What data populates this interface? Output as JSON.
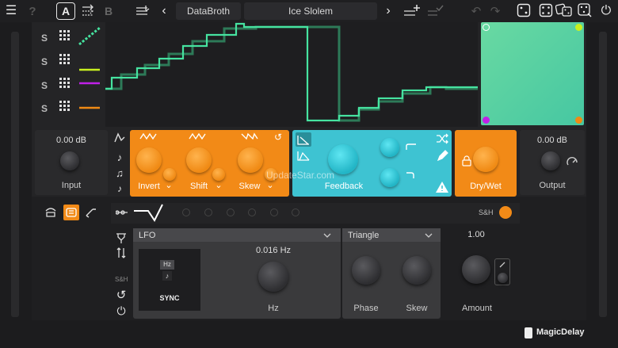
{
  "toolbar": {
    "menu_icon": "hamburger-icon",
    "help": "?",
    "a_label": "A",
    "b_label": "B",
    "prev": "‹",
    "next": "›",
    "preset_bank": "DataBroth",
    "preset_name": "Ice Slolem"
  },
  "lanes": {
    "s_labels": [
      "S",
      "S",
      "S",
      "S"
    ],
    "colors": [
      "#46e3a0",
      "#c8f020",
      "#c020e8",
      "#f08a14"
    ]
  },
  "graph": {
    "freq_labels": [
      "",
      "",
      ""
    ]
  },
  "xy_pad": {
    "corner_colors": [
      "#e8e8e8",
      "#c8f020",
      "#c020e8",
      "#f08a14"
    ]
  },
  "input": {
    "value": "0.00 dB",
    "label": "Input"
  },
  "output": {
    "value": "0.00 dB",
    "label": "Output"
  },
  "orange_section": {
    "invert_label": "Invert",
    "shift_label": "Shift",
    "skew_label": "Skew",
    "chev": "⌄"
  },
  "feedback": {
    "label": "Feedback"
  },
  "drywet": {
    "label": "Dry/Wet"
  },
  "watermark": "UpdateStar.com",
  "mod": {
    "sh_label": "S&H",
    "lfo": {
      "source": "LFO",
      "freq_value": "0.016 Hz",
      "freq_label": "Hz",
      "sync_label": "SYNC",
      "hz_badge": "Hz",
      "note_badge": "♪"
    },
    "shape": {
      "name": "Triangle",
      "phase_label": "Phase",
      "skew_label": "Skew"
    },
    "amount": {
      "value": "1.00",
      "label": "Amount"
    },
    "sh_side": "S&H"
  },
  "brand": {
    "name": "MagicDelay"
  },
  "colors": {
    "orange": "#f28a17",
    "cyan": "#3ec3d2",
    "green": "#46e3a0"
  }
}
